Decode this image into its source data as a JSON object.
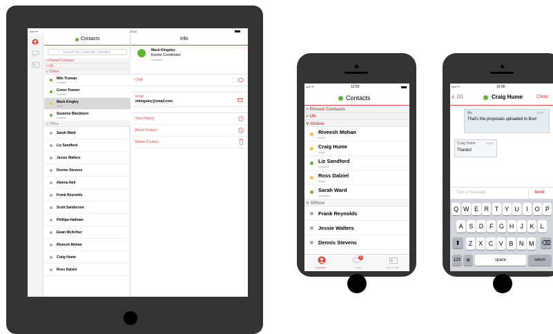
{
  "colors": {
    "accent": "#e8483f",
    "available": "#5cb82f",
    "away": "#f4c33d",
    "offline": "#a8a8a8",
    "device": "#333333"
  },
  "ipad": {
    "status": {
      "signal": "••••• ᯤ",
      "time": "12:12"
    },
    "sidebar_icons": [
      "contacts-icon",
      "chats-icon",
      "profile-icon"
    ],
    "contacts_title": "Contacts",
    "search_placeholder": "Search the Corporate Directory",
    "groups": {
      "pinned": "Pinned Contacts",
      "us": "US",
      "online": "Online",
      "offline": "Offline"
    },
    "online": [
      {
        "name": "Mile Truman",
        "status": "Available",
        "state": "available"
      },
      {
        "name": "Conor Towner",
        "status": "Available",
        "state": "available"
      },
      {
        "name": "Mack Kingley",
        "status": "Away",
        "state": "away"
      },
      {
        "name": "Suzanne Blackburn",
        "status": "Available",
        "state": "available"
      }
    ],
    "offline": [
      "Sarah Ward",
      "Liz Sandford",
      "Jessie Walters",
      "Dennis Stevens",
      "Alanna Neil",
      "Frank Reynolds",
      "Scott Sanderson",
      "Phillipa Hallman",
      "Ewan McArthur",
      "Riveesh Mohan",
      "Craig Hume",
      "Ross Dalziel"
    ],
    "info": {
      "title": "Info",
      "name": "Mack Kingsley",
      "role": "Events Coordinator",
      "status": "Available",
      "chat_label": "Chat",
      "email_label": "Email",
      "email_value": "mkingsley@email.com",
      "actions": [
        "View History",
        "Block Contact",
        "Delete Contact"
      ]
    }
  },
  "phone1": {
    "status": {
      "signal": "••••• ᯤ",
      "time": "12:55"
    },
    "title": "Contacts",
    "groups": {
      "pinned": "Pinned Contacts",
      "us": "US",
      "online": "Online",
      "offline": "Offline"
    },
    "online": [
      {
        "name": "Riveesh Mohan",
        "status": "Away",
        "state": "away"
      },
      {
        "name": "Craig Hume",
        "status": "Away",
        "state": "away"
      },
      {
        "name": "Liz Sandford",
        "status": "Available",
        "state": "available"
      },
      {
        "name": "Ross Dalziel",
        "status": "Away",
        "state": "away"
      },
      {
        "name": "Sarah Ward",
        "status": "Available",
        "state": "available"
      }
    ],
    "offline": [
      "Frank Reynolds",
      "Jessie Walters",
      "Dennis Stevens"
    ],
    "tabs": [
      {
        "label": "Contacts",
        "icon": "contacts-icon"
      },
      {
        "label": "Chats",
        "icon": "chats-icon",
        "badge": "2"
      },
      {
        "label": "My Profile",
        "icon": "profile-icon"
      }
    ]
  },
  "phone2": {
    "status": {
      "signal": "••••• ᯤ",
      "time": "16:06"
    },
    "back_label": "(2)",
    "title": "Craig Hume",
    "clear_label": "Clear",
    "messages": [
      {
        "sender": "Me",
        "time": "16:05",
        "text": "That's the proposals uploaded to Box!"
      },
      {
        "sender": "Craig Hume",
        "time": "16:05",
        "text": "Thanks!"
      }
    ],
    "input_placeholder": "Type a message",
    "send_label": "Send",
    "keyboard": {
      "row1": [
        "Q",
        "W",
        "E",
        "R",
        "T",
        "Y",
        "U",
        "I",
        "O",
        "P"
      ],
      "row2": [
        "A",
        "S",
        "D",
        "F",
        "G",
        "H",
        "J",
        "K",
        "L"
      ],
      "row3": [
        "Z",
        "X",
        "C",
        "V",
        "B",
        "N",
        "M"
      ],
      "numbers": "123",
      "space": "space",
      "return": "return"
    }
  }
}
